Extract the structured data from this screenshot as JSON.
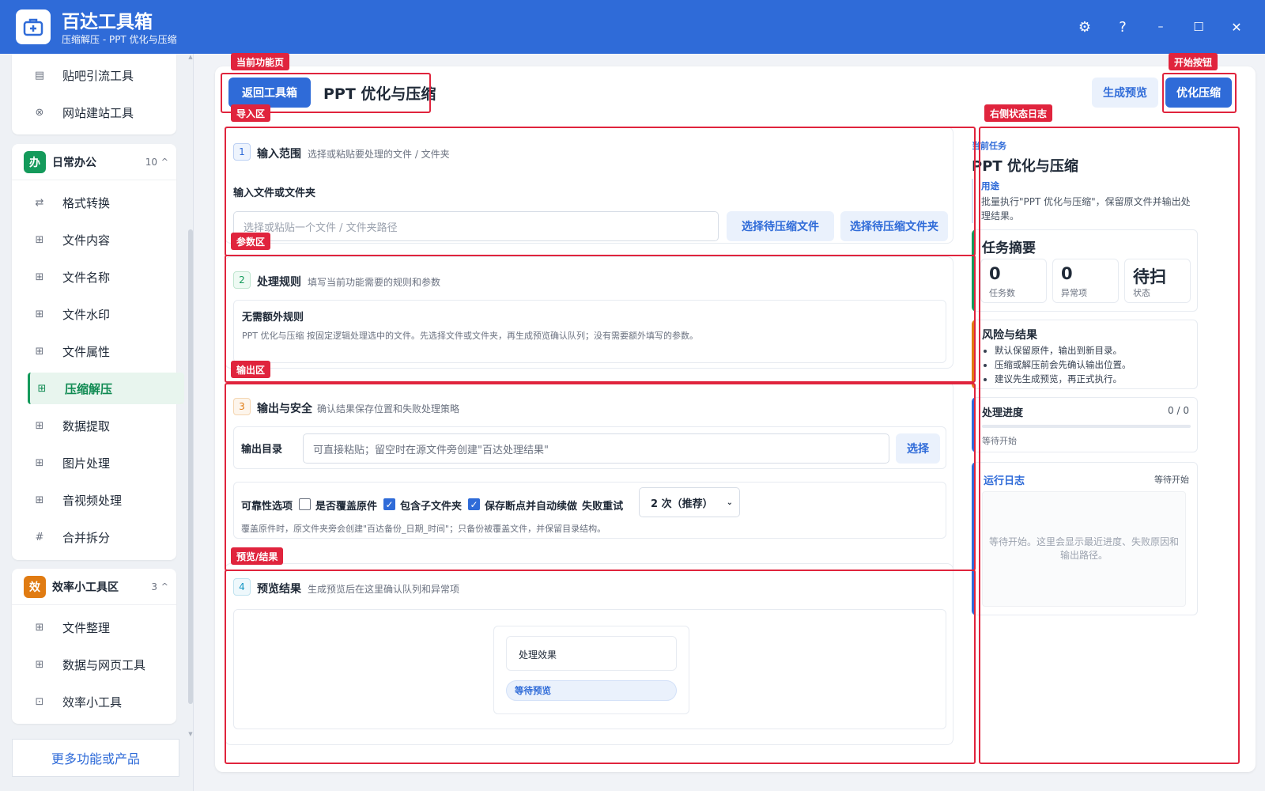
{
  "titlebar": {
    "title": "百达工具箱",
    "subtitle": "压缩解压 - PPT 优化与压缩",
    "settings_icon": "⚙",
    "help_icon": "?",
    "minimize_icon": "–",
    "maximize_icon": "☐",
    "close_icon": "✕"
  },
  "sidebar": {
    "top_items": [
      {
        "label": "贴吧引流工具",
        "icon": "▤"
      },
      {
        "label": "网站建站工具",
        "icon": "⊗"
      }
    ],
    "group_daily": {
      "badge": "办",
      "title": "日常办公",
      "count": "10",
      "caret": "^",
      "items": [
        {
          "label": "格式转换",
          "icon": "⇄"
        },
        {
          "label": "文件内容",
          "icon": "⊞"
        },
        {
          "label": "文件名称",
          "icon": "⊞"
        },
        {
          "label": "文件水印",
          "icon": "⊞"
        },
        {
          "label": "文件属性",
          "icon": "⊞"
        },
        {
          "label": "压缩解压",
          "icon": "⊞"
        },
        {
          "label": "数据提取",
          "icon": "⊞"
        },
        {
          "label": "图片处理",
          "icon": "⊞"
        },
        {
          "label": "音视频处理",
          "icon": "⊞"
        },
        {
          "label": "合并拆分",
          "icon": "#"
        }
      ]
    },
    "group_efficiency": {
      "badge": "效",
      "title": "效率小工具区",
      "count": "3",
      "caret": "^",
      "items": [
        {
          "label": "文件整理",
          "icon": "⊞"
        },
        {
          "label": "数据与网页工具",
          "icon": "⊞"
        },
        {
          "label": "效率小工具",
          "icon": "⊡"
        }
      ]
    },
    "more": "更多功能或产品",
    "scroll_up": "▲",
    "scroll_down": "▼"
  },
  "main": {
    "back_button": "返回工具箱",
    "page_title": "PPT 优化与压缩",
    "preview_button": "生成预览",
    "start_button": "优化压缩",
    "section1": {
      "num": "1",
      "title": "输入范围",
      "desc": "选择或粘贴要处理的文件 / 文件夹",
      "field_label": "输入文件或文件夹",
      "input_placeholder": "选择或粘贴一个文件 / 文件夹路径",
      "btn_file": "选择待压缩文件",
      "btn_folder": "选择待压缩文件夹"
    },
    "section2": {
      "num": "2",
      "title": "处理规则",
      "desc": "填写当前功能需要的规则和参数",
      "box_title": "无需额外规则",
      "box_desc": "PPT 优化与压缩 按固定逻辑处理选中的文件。先选择文件或文件夹，再生成预览确认队列；没有需要额外填写的参数。"
    },
    "section3": {
      "num": "3",
      "title": "输出与安全",
      "desc": "确认结果保存位置和失败处理策略",
      "output_label": "输出目录",
      "output_placeholder": "可直接粘贴；留空时在源文件旁创建\"百达处理结果\"",
      "output_btn": "选择",
      "reliability_label": "可靠性选项",
      "opt_overwrite": "是否覆盖原件",
      "opt_subfolders": "包含子文件夹",
      "opt_resume": "保存断点并自动续做",
      "retry_label": "失败重试",
      "retry_value": "2 次（推荐）",
      "note": "覆盖原件时，原文件夹旁会创建\"百达备份_日期_时间\"；只备份被覆盖文件，并保留目录结构。"
    },
    "section4": {
      "num": "4",
      "title": "预览结果",
      "desc": "生成预览后在这里确认队列和异常项",
      "effect_label": "处理效果",
      "status_pill": "等待预览"
    }
  },
  "right": {
    "task_label": "当前任务",
    "task_title": "PPT 优化与压缩",
    "purpose_label": "用途",
    "purpose_text": "批量执行\"PPT 优化与压缩\"，保留原文件并输出处理结果。",
    "summary_title": "任务摘要",
    "stats": [
      {
        "value": "0",
        "label": "任务数"
      },
      {
        "value": "0",
        "label": "异常项"
      },
      {
        "value": "待扫",
        "label": "状态"
      }
    ],
    "risk_title": "风险与结果",
    "risks": [
      "默认保留原件，输出到新目录。",
      "压缩或解压前会先确认输出位置。",
      "建议先生成预览，再正式执行。"
    ],
    "progress_title": "处理进度",
    "progress_count": "0 / 0",
    "progress_value": 0,
    "progress_status": "等待开始",
    "log_title": "运行日志",
    "log_status": "等待开始",
    "log_placeholder": "等待开始。这里会显示最近进度、失败原因和输出路径。"
  },
  "annotations": {
    "current_page": "当前功能页",
    "start_button": "开始按钮",
    "import_area": "导入区",
    "right_log": "右侧状态日志",
    "params_area": "参数区",
    "output_area": "输出区",
    "preview_area": "预览/结果"
  },
  "colors": {
    "brand": "#2f6bd8",
    "active_green": "#149a5b",
    "annotation_red": "#e0243d",
    "badge_daily": "#149a5b",
    "badge_efficiency": "#e07b12"
  }
}
